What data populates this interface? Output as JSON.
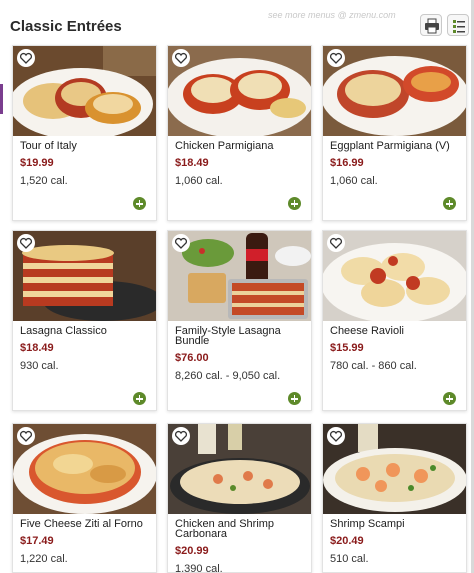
{
  "header": {
    "title": "Classic Entrées",
    "watermark": "see more menus @ zmenu.com"
  },
  "toolbar": {
    "print_icon": "printer-icon",
    "list_icon": "list-view-icon"
  },
  "colors": {
    "price": "#8a1b1b",
    "add_button": "#5e8a2a",
    "accent_edge": "#7a3d8e"
  },
  "items": [
    {
      "name": "Tour of Italy",
      "price": "$19.99",
      "calories": "1,520 cal."
    },
    {
      "name": "Chicken Parmigiana",
      "price": "$18.49",
      "calories": "1,060 cal."
    },
    {
      "name": "Eggplant Parmigiana (V)",
      "price": "$16.99",
      "calories": "1,060 cal."
    },
    {
      "name": "Lasagna Classico",
      "price": "$18.49",
      "calories": "930 cal."
    },
    {
      "name": "Family-Style Lasagna Bundle",
      "price": "$76.00",
      "calories": "8,260 cal. - 9,050 cal."
    },
    {
      "name": "Cheese Ravioli",
      "price": "$15.99",
      "calories": "780 cal. - 860 cal."
    },
    {
      "name": "Five Cheese Ziti al Forno",
      "price": "$17.49",
      "calories": "1,220 cal."
    },
    {
      "name": "Chicken and Shrimp Carbonara",
      "price": "$20.99",
      "calories": "1,390 cal."
    },
    {
      "name": "Shrimp Scampi",
      "price": "$20.49",
      "calories": "510 cal."
    }
  ]
}
